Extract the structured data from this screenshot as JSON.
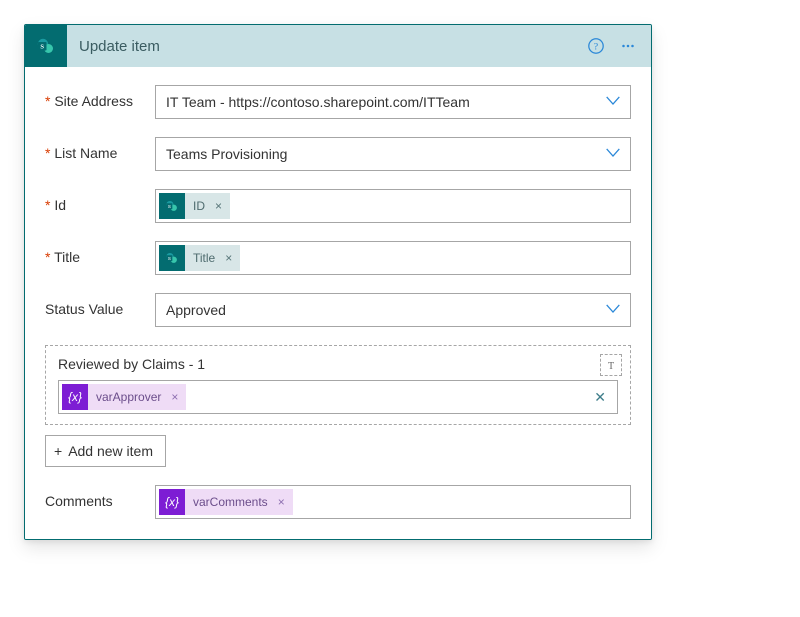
{
  "header": {
    "title": "Update item"
  },
  "labels": {
    "siteAddress": "Site Address",
    "listName": "List Name",
    "id": "Id",
    "title": "Title",
    "statusValue": "Status Value",
    "reviewedBy": "Reviewed by Claims - 1",
    "addNewItem": "Add new item",
    "comments": "Comments",
    "textModeGlyph": "T"
  },
  "values": {
    "siteAddress": "IT Team - https://contoso.sharepoint.com/ITTeam",
    "listName": "Teams Provisioning",
    "statusValue": "Approved"
  },
  "tokens": {
    "idLabel": "ID",
    "titleLabel": "Title",
    "varApprover": "varApprover",
    "varComments": "varComments",
    "closeGlyph": "×",
    "plusGlyph": "+",
    "clearGlyph": "✕",
    "fxGlyph": "{x}"
  }
}
